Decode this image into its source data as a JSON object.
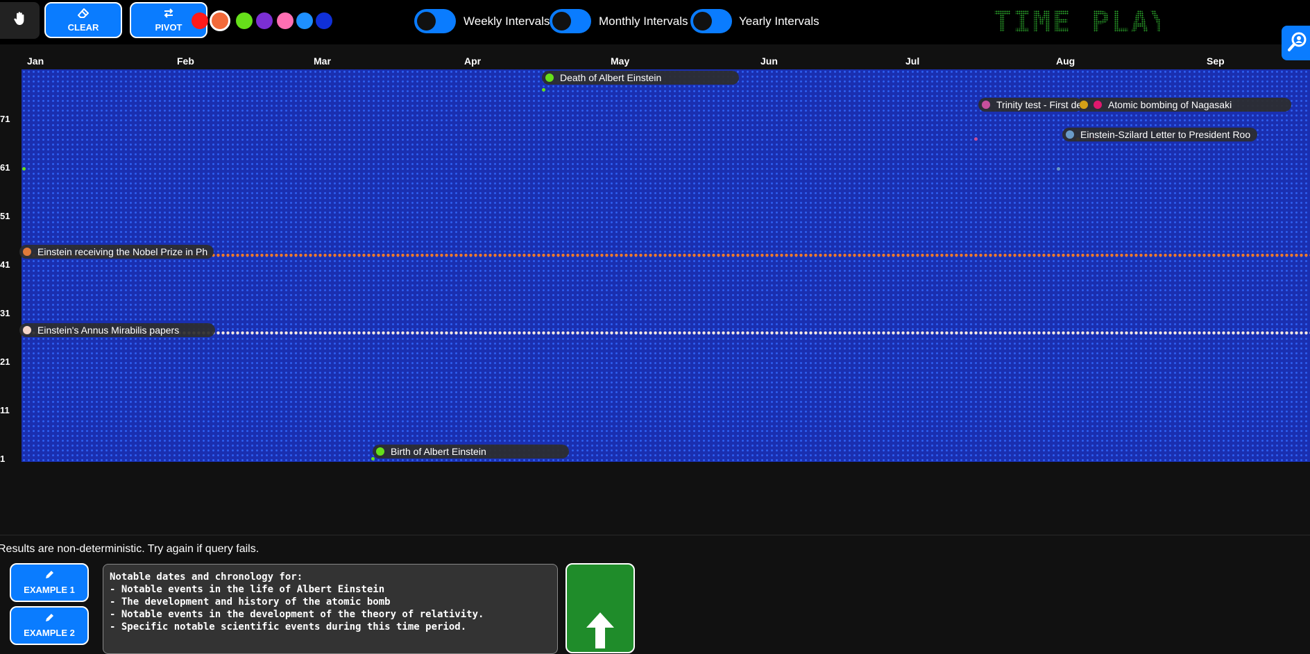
{
  "toolbar": {
    "clear_label": "CLEAR",
    "pivot_label": "PIVOT",
    "colors": [
      "#ff1a1a",
      "#f26a3a",
      "#66e01a",
      "#7b2fd4",
      "#ff6fb3",
      "#1e90ff",
      "#1030d8"
    ],
    "selected_color": "#f26a3a",
    "toggles": [
      {
        "label": "Weekly Intervals",
        "on": false
      },
      {
        "label": "Monthly Intervals",
        "on": false
      },
      {
        "label": "Yearly Intervals",
        "on": false
      }
    ],
    "logo_text": "TIME PLAY"
  },
  "timeline": {
    "months": [
      "Jan",
      "Feb",
      "Mar",
      "Apr",
      "May",
      "Jun",
      "Jul",
      "Aug",
      "Sep"
    ],
    "row_labels": [
      "71",
      "61",
      "51",
      "41",
      "31",
      "21",
      "11",
      "1"
    ],
    "events": [
      {
        "label": "Death of Albert Einstein",
        "color": "#66e01a"
      },
      {
        "label": "Trinity test - First de",
        "color": "#c84f9c"
      },
      {
        "label": "Atomic bombing of Nagasaki",
        "color": "#e0186e"
      },
      {
        "label": "Einstein-Szilard Letter to President Roo",
        "color": "#6a9bc8"
      },
      {
        "label": "Einstein receiving the Nobel Prize in Ph",
        "color": "#e07a3a"
      },
      {
        "label": "Einstein's Annus Mirabilis papers",
        "color": "#f5d5c8"
      },
      {
        "label": "Birth of Albert Einstein",
        "color": "#66e01a"
      }
    ],
    "extra_marker_color": "#d4a017",
    "highlight_rows": [
      {
        "color": "#f07a2a"
      },
      {
        "color": "#f5e6e0"
      }
    ]
  },
  "bottom": {
    "note": "Results are non-deterministic. Try again if query fails.",
    "example1_label": "EXAMPLE 1",
    "example2_label": "EXAMPLE 2",
    "query_text": "Notable dates and chronology for:\n- Notable events in the life of Albert Einstein\n- The development and history of the atomic bomb\n- Notable events in the development of the theory of relativity.\n- Specific notable scientific events during this time period."
  }
}
